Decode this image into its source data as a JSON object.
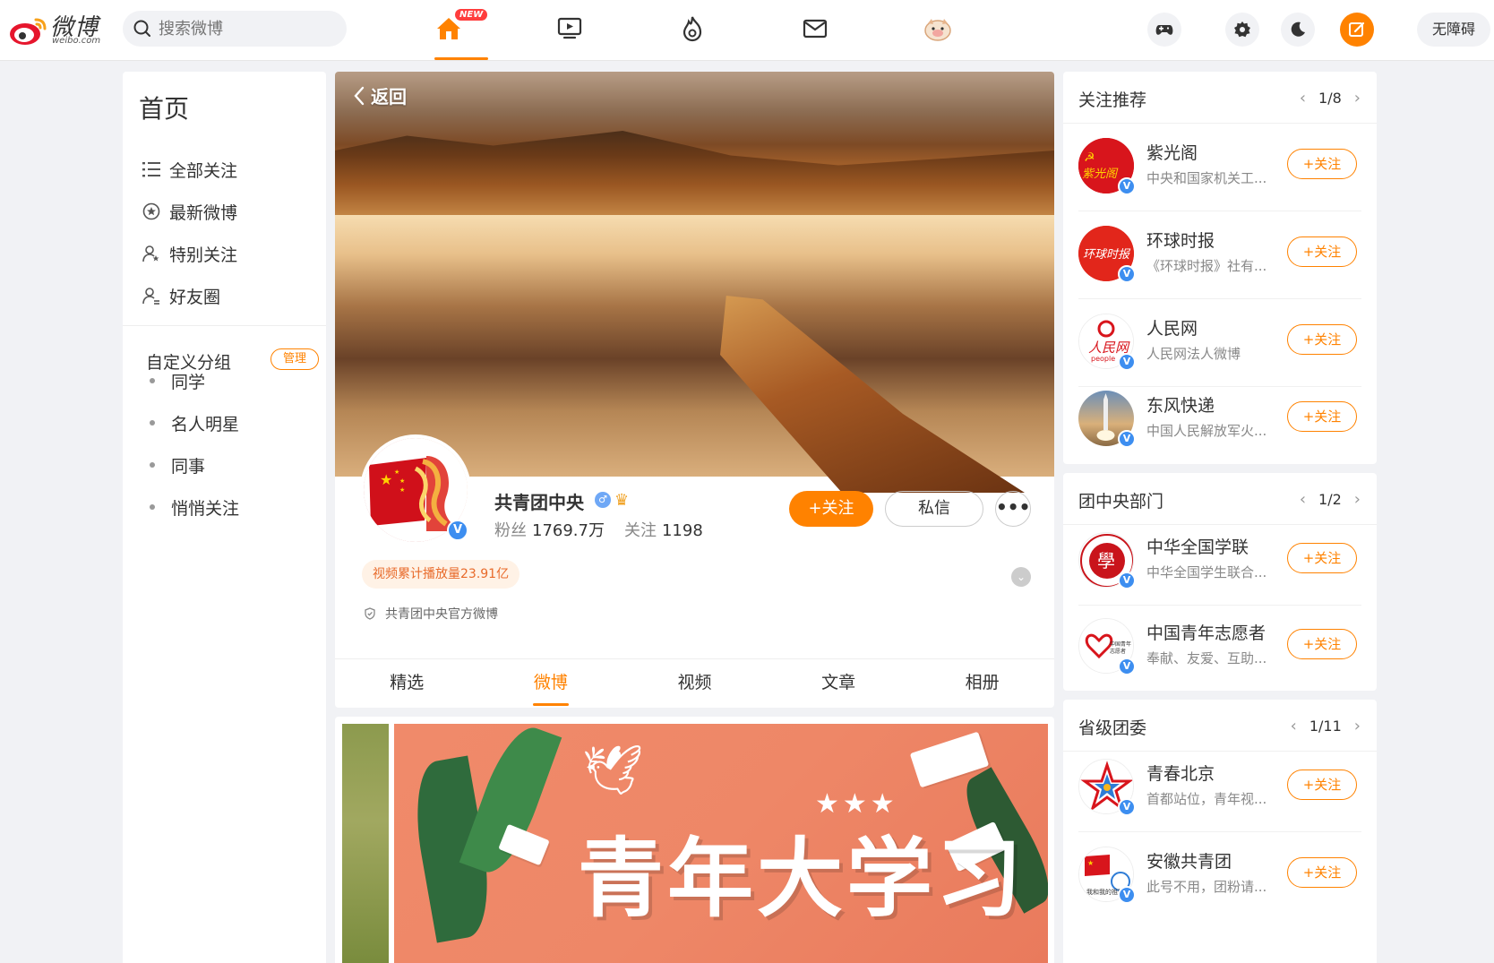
{
  "topbar": {
    "brand": "微博",
    "brand_sub": "weibo.com",
    "search_placeholder": "搜索微博",
    "new_badge": "NEW",
    "accessibility": "无障碍"
  },
  "left_nav": {
    "title": "首页",
    "items": [
      {
        "label": "全部关注",
        "icon": "list-icon"
      },
      {
        "label": "最新微博",
        "icon": "star-circle-icon"
      },
      {
        "label": "特别关注",
        "icon": "user-star-icon"
      },
      {
        "label": "好友圈",
        "icon": "user-group-icon"
      }
    ],
    "custom_group_title": "自定义分组",
    "manage_label": "管理",
    "groups": [
      "同学",
      "名人明星",
      "同事",
      "悄悄关注"
    ]
  },
  "profile": {
    "back_label": "返回",
    "name": "共青团中央",
    "fans_label": "粉丝",
    "fans_value": "1769.7万",
    "following_label": "关注",
    "following_value": "1198",
    "follow_label": "+关注",
    "message_label": "私信",
    "more_label": "•••",
    "play_count_tag": "视频累计播放量23.91亿",
    "official_text": "共青团中央官方微博",
    "tabs": [
      "精选",
      "微博",
      "视频",
      "文章",
      "相册"
    ],
    "active_tab": "微博",
    "accent_color": "#ff8200"
  },
  "feed": {
    "poster_text": "青年大学习"
  },
  "right": {
    "cards": [
      {
        "title": "关注推荐",
        "page": "1/8",
        "items": [
          {
            "name": "紫光阁",
            "desc": "中央和国家机关工...",
            "follow": "+关注"
          },
          {
            "name": "环球时报",
            "desc": "《环球时报》社有...",
            "follow": "+关注"
          },
          {
            "name": "人民网",
            "desc": "人民网法人微博",
            "follow": "+关注"
          },
          {
            "name": "东风快递",
            "desc": "中国人民解放军火...",
            "follow": "+关注"
          }
        ]
      },
      {
        "title": "团中央部门",
        "page": "1/2",
        "items": [
          {
            "name": "中华全国学联",
            "desc": "中华全国学生联合...",
            "follow": "+关注"
          },
          {
            "name": "中国青年志愿者",
            "desc": "奉献、友爱、互助...",
            "follow": "+关注"
          }
        ]
      },
      {
        "title": "省级团委",
        "page": "1/11",
        "items": [
          {
            "name": "青春北京",
            "desc": "首都站位，青年视...",
            "follow": "+关注"
          },
          {
            "name": "安徽共青团",
            "desc": "此号不用，团粉请...",
            "follow": "+关注"
          }
        ]
      }
    ]
  }
}
